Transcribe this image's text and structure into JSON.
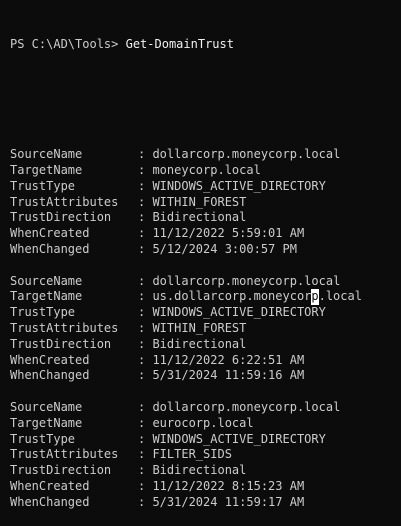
{
  "terminal": {
    "prompt": "PS C:\\AD\\Tools>",
    "command": "Get-DomainTrust",
    "separator": ": ",
    "records": [
      {
        "fields": [
          {
            "name": "SourceName",
            "value": "dollarcorp.moneycorp.local"
          },
          {
            "name": "TargetName",
            "value": "moneycorp.local"
          },
          {
            "name": "TrustType",
            "value": "WINDOWS_ACTIVE_DIRECTORY"
          },
          {
            "name": "TrustAttributes",
            "value": "WITHIN_FOREST"
          },
          {
            "name": "TrustDirection",
            "value": "Bidirectional"
          },
          {
            "name": "WhenCreated",
            "value": "11/12/2022 5:59:01 AM"
          },
          {
            "name": "WhenChanged",
            "value": "5/12/2024 3:00:57 PM"
          }
        ]
      },
      {
        "fields": [
          {
            "name": "SourceName",
            "value": "dollarcorp.moneycorp.local"
          },
          {
            "name": "TargetName",
            "value": "us.dollarcorp.moneycorp.local",
            "cursor_before": "us.dollarcorp.moneycor",
            "cursor_char": "p",
            "cursor_after": ".local"
          },
          {
            "name": "TrustType",
            "value": "WINDOWS_ACTIVE_DIRECTORY"
          },
          {
            "name": "TrustAttributes",
            "value": "WITHIN_FOREST"
          },
          {
            "name": "TrustDirection",
            "value": "Bidirectional"
          },
          {
            "name": "WhenCreated",
            "value": "11/12/2022 6:22:51 AM"
          },
          {
            "name": "WhenChanged",
            "value": "5/31/2024 11:59:16 AM"
          }
        ]
      },
      {
        "fields": [
          {
            "name": "SourceName",
            "value": "dollarcorp.moneycorp.local"
          },
          {
            "name": "TargetName",
            "value": "eurocorp.local"
          },
          {
            "name": "TrustType",
            "value": "WINDOWS_ACTIVE_DIRECTORY"
          },
          {
            "name": "TrustAttributes",
            "value": "FILTER_SIDS"
          },
          {
            "name": "TrustDirection",
            "value": "Bidirectional"
          },
          {
            "name": "WhenCreated",
            "value": "11/12/2022 8:15:23 AM"
          },
          {
            "name": "WhenChanged",
            "value": "5/31/2024 11:59:17 AM"
          }
        ]
      }
    ]
  },
  "colors": {
    "background": "#0c0c0c",
    "foreground": "#cccccc",
    "cursor": "#ffffff"
  }
}
